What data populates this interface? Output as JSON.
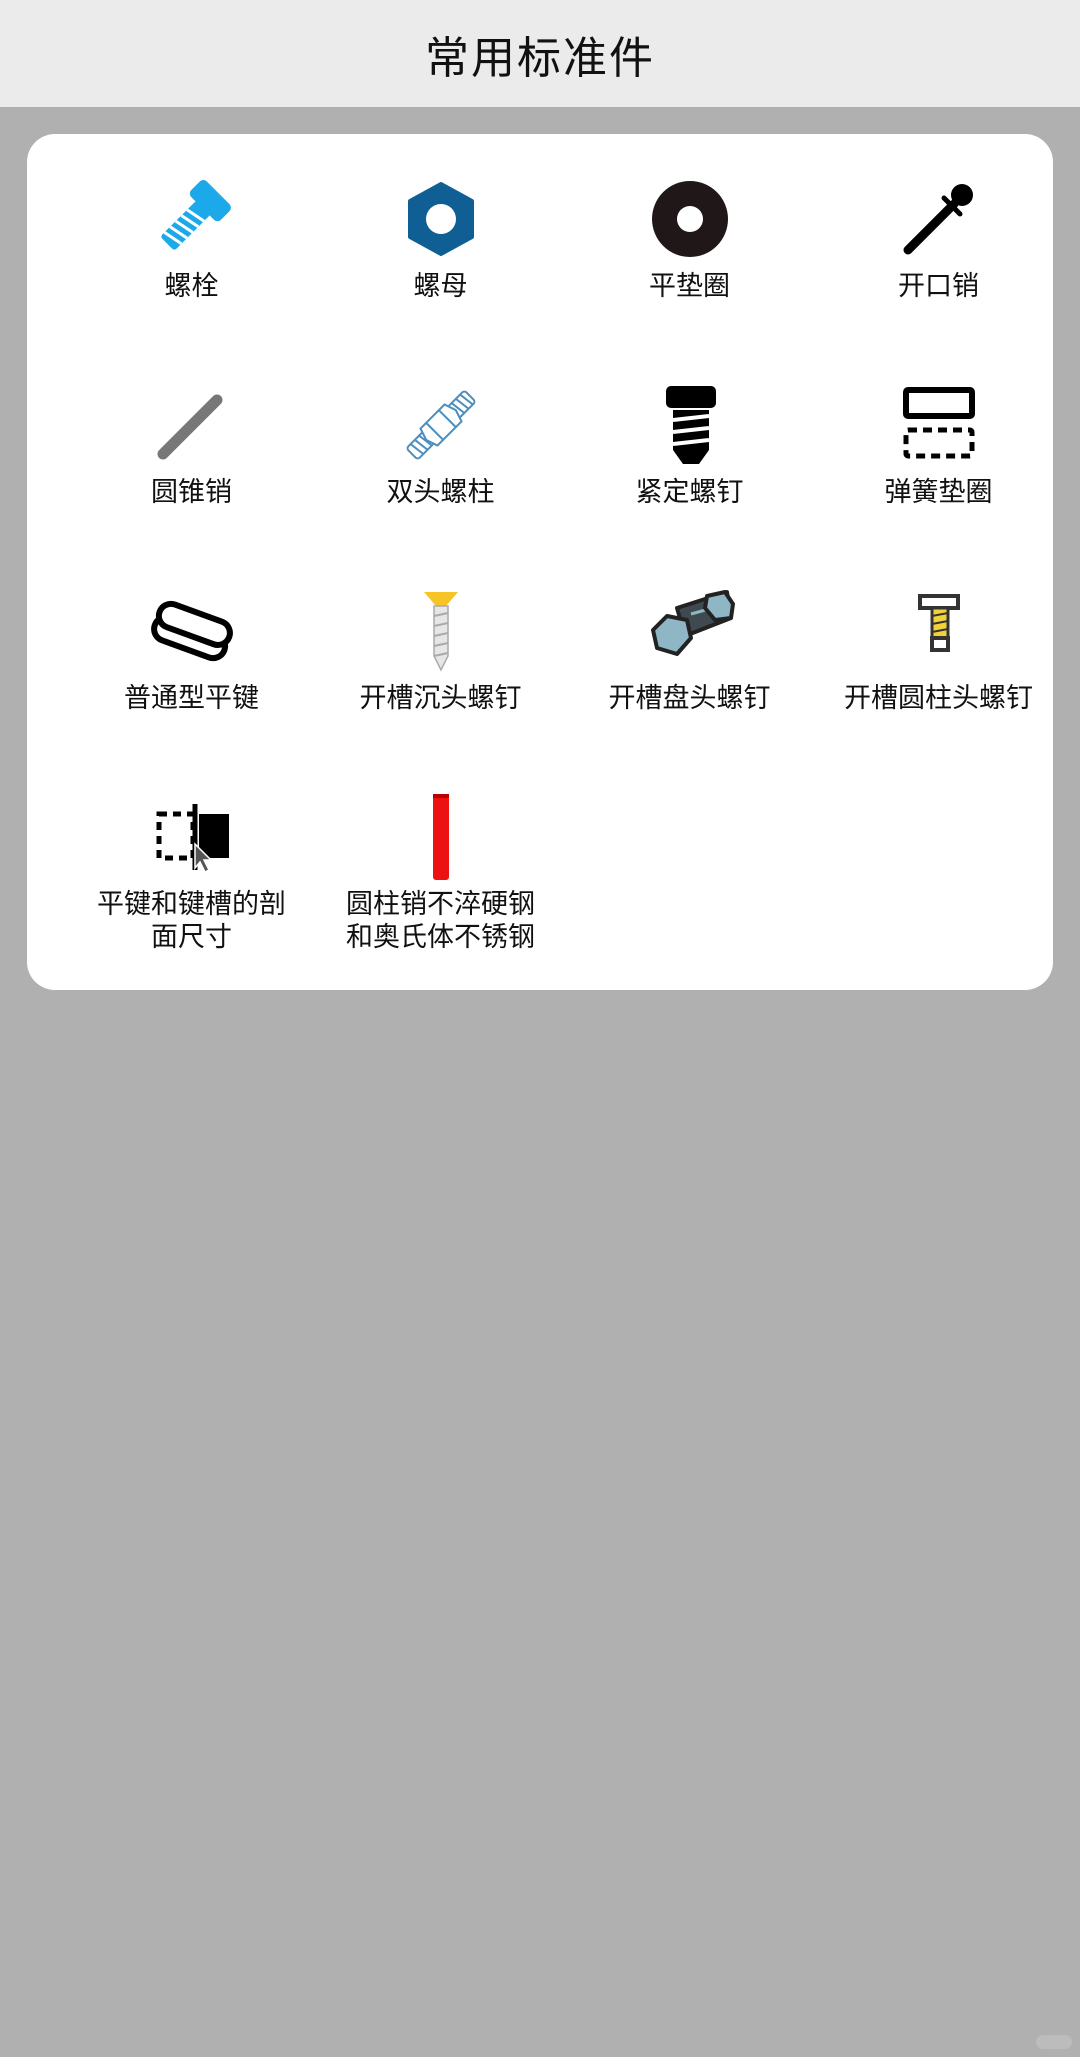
{
  "header": {
    "title": "常用标准件"
  },
  "items": [
    {
      "label": "螺栓",
      "icon": "bolt-icon"
    },
    {
      "label": "螺母",
      "icon": "hex-nut-icon"
    },
    {
      "label": "平垫圈",
      "icon": "flat-washer-icon"
    },
    {
      "label": "开口销",
      "icon": "cotter-pin-icon"
    },
    {
      "label": "圆锥销",
      "icon": "taper-pin-icon"
    },
    {
      "label": "双头螺柱",
      "icon": "double-end-stud-icon"
    },
    {
      "label": "紧定螺钉",
      "icon": "set-screw-icon"
    },
    {
      "label": "弹簧垫圈",
      "icon": "spring-washer-icon"
    },
    {
      "label": "普通型平键",
      "icon": "flat-key-icon"
    },
    {
      "label": "开槽沉头螺钉",
      "icon": "countersunk-screw-icon"
    },
    {
      "label": "开槽盘头螺钉",
      "icon": "pan-head-screw-icon"
    },
    {
      "label": "开槽圆柱头螺钉",
      "icon": "cheese-head-screw-icon"
    },
    {
      "label": "平键和键槽的剖面尺寸",
      "icon": "key-section-icon"
    },
    {
      "label": "圆柱销不淬硬钢和奥氏体不锈钢",
      "icon": "cylindrical-pin-icon"
    }
  ],
  "colors": {
    "header_bg": "#ebebeb",
    "page_bg": "#b1b0b1",
    "card_bg": "#ffffff",
    "bolt": "#1ba9ea",
    "nut": "#0f5f94",
    "washer": "#201818",
    "cylindrical_pin": "#ee1111"
  }
}
